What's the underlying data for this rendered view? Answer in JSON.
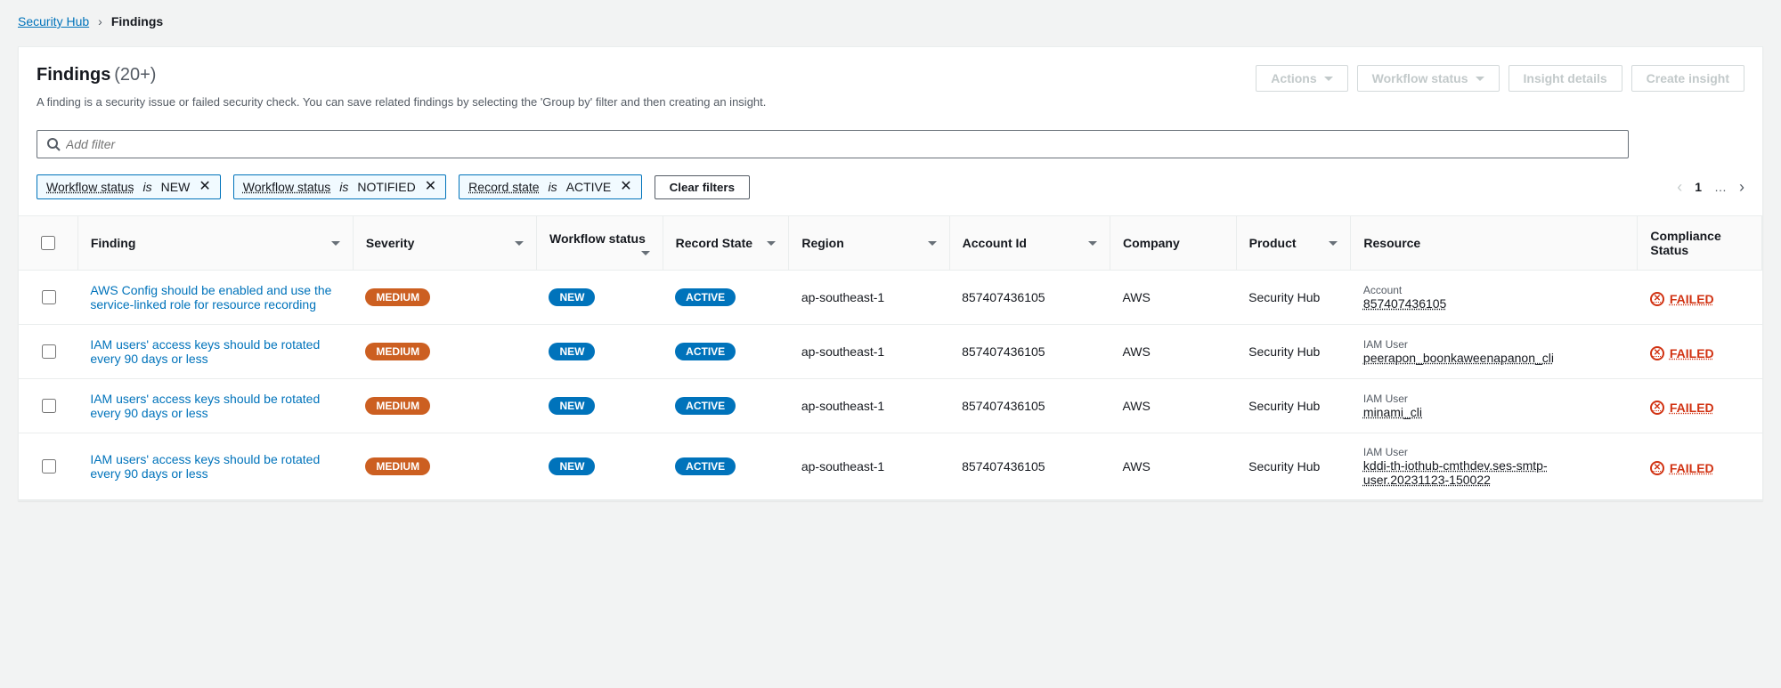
{
  "breadcrumb": {
    "root": "Security Hub",
    "current": "Findings"
  },
  "header": {
    "title": "Findings",
    "count": "(20+)",
    "subtitle": "A finding is a security issue or failed security check. You can save related findings by selecting the 'Group by' filter and then creating an insight."
  },
  "buttons": {
    "actions": "Actions",
    "workflow_status": "Workflow status",
    "insight_details": "Insight details",
    "create_insight": "Create insight",
    "clear_filters": "Clear filters"
  },
  "filter_input": {
    "placeholder": "Add filter"
  },
  "chips": [
    {
      "label": "Workflow status",
      "op": "is",
      "val": "NEW"
    },
    {
      "label": "Workflow status",
      "op": "is",
      "val": "NOTIFIED"
    },
    {
      "label": "Record state",
      "op": "is",
      "val": "ACTIVE"
    }
  ],
  "pager": {
    "page": "1",
    "ellipsis": "…"
  },
  "columns": {
    "finding": "Finding",
    "severity": "Severity",
    "workflow": "Workflow status",
    "record_state": "Record State",
    "region": "Region",
    "account_id": "Account Id",
    "company": "Company",
    "product": "Product",
    "resource": "Resource",
    "compliance": "Compliance Status"
  },
  "rows": [
    {
      "finding": "AWS Config should be enabled and use the service-linked role for resource recording",
      "severity": "MEDIUM",
      "workflow": "NEW",
      "record_state": "ACTIVE",
      "region": "ap-southeast-1",
      "account_id": "857407436105",
      "company": "AWS",
      "product": "Security Hub",
      "resource_type": "Account",
      "resource_value": "857407436105",
      "compliance": "FAILED"
    },
    {
      "finding": "IAM users' access keys should be rotated every 90 days or less",
      "severity": "MEDIUM",
      "workflow": "NEW",
      "record_state": "ACTIVE",
      "region": "ap-southeast-1",
      "account_id": "857407436105",
      "company": "AWS",
      "product": "Security Hub",
      "resource_type": "IAM User",
      "resource_value": "peerapon_boonkaweenapanon_cli",
      "compliance": "FAILED"
    },
    {
      "finding": "IAM users' access keys should be rotated every 90 days or less",
      "severity": "MEDIUM",
      "workflow": "NEW",
      "record_state": "ACTIVE",
      "region": "ap-southeast-1",
      "account_id": "857407436105",
      "company": "AWS",
      "product": "Security Hub",
      "resource_type": "IAM User",
      "resource_value": "minami_cli",
      "compliance": "FAILED"
    },
    {
      "finding": "IAM users' access keys should be rotated every 90 days or less",
      "severity": "MEDIUM",
      "workflow": "NEW",
      "record_state": "ACTIVE",
      "region": "ap-southeast-1",
      "account_id": "857407436105",
      "company": "AWS",
      "product": "Security Hub",
      "resource_type": "IAM User",
      "resource_value": "kddi-th-iothub-cmthdev.ses-smtp-user.20231123-150022",
      "compliance": "FAILED"
    }
  ]
}
